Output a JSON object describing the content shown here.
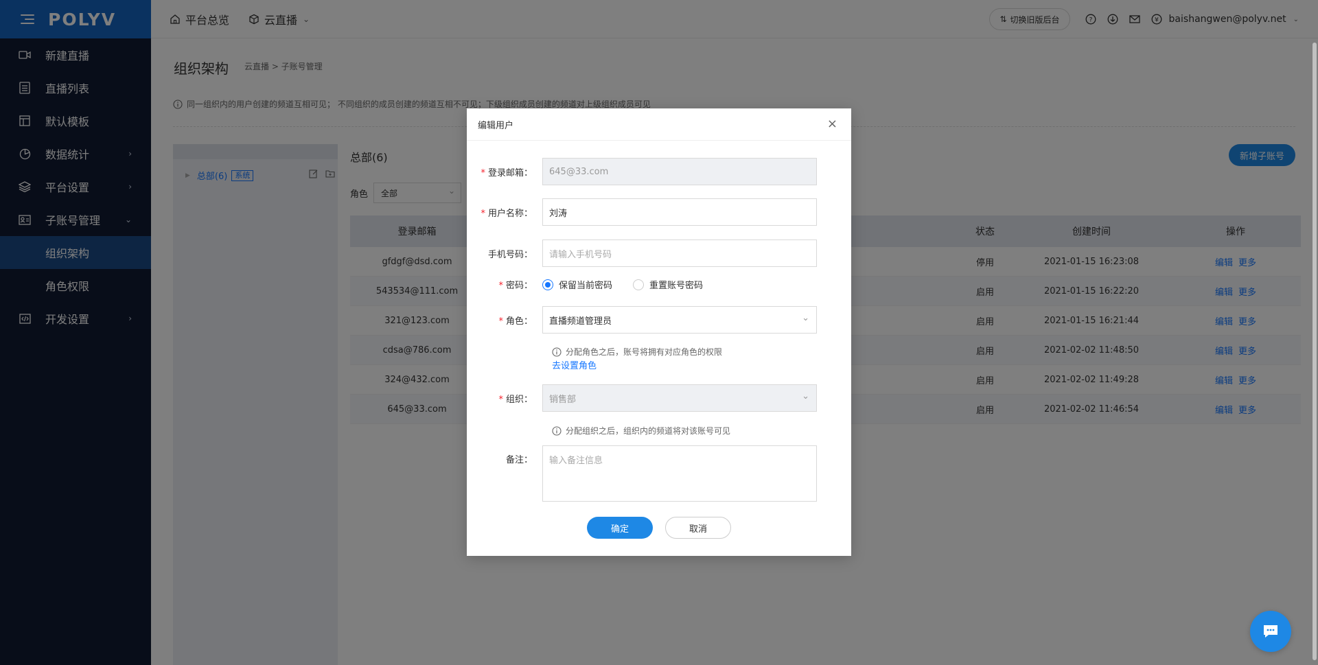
{
  "brand": {
    "logo": "POLYV",
    "accent": "#1565c0",
    "sidebar_bg": "#101a33"
  },
  "sidebar": {
    "items": [
      {
        "label": "新建直播",
        "icon": "video-camera-icon"
      },
      {
        "label": "直播列表",
        "icon": "list-icon"
      },
      {
        "label": "默认模板",
        "icon": "template-icon"
      },
      {
        "label": "数据统计",
        "icon": "pie-chart-icon"
      },
      {
        "label": "平台设置",
        "icon": "layers-icon"
      },
      {
        "label": "子账号管理",
        "icon": "id-card-icon"
      },
      {
        "label": "开发设置",
        "icon": "code-icon"
      }
    ],
    "sub_items": [
      {
        "label": "组织架构",
        "active": true
      },
      {
        "label": "角色权限",
        "active": false
      }
    ]
  },
  "topbar": {
    "nav": [
      {
        "label": "平台总览",
        "icon": "home-icon"
      },
      {
        "label": "云直播",
        "icon": "cube-icon"
      }
    ],
    "switch_label": "切换旧版后台",
    "user": "baishangwen@polyv.net"
  },
  "page": {
    "title": "组织架构",
    "breadcrumb": "云直播 >  子账号管理",
    "notice": "同一组织内的用户创建的频道互相可见；  不同组织的成员创建的频道互相不可见；下级组织成员创建的频道对上级组织成员可见"
  },
  "tree": {
    "node_label": "总部(6)",
    "tag": "系统"
  },
  "content": {
    "group_title": "总部(6)",
    "add_button": "新增子账号",
    "filter_label": "角色",
    "filter_value": "全部",
    "columns": {
      "email": "登录邮箱",
      "status": "状态",
      "created": "创建时间",
      "ops": "操作"
    },
    "rows": [
      {
        "email": "gfdgf@dsd.com",
        "status": "停用",
        "created": "2021-01-15 16:23:08"
      },
      {
        "email": "543534@111.com",
        "status": "启用",
        "created": "2021-01-15 16:22:20"
      },
      {
        "email": "321@123.com",
        "status": "启用",
        "created": "2021-01-15 16:21:44"
      },
      {
        "email": "cdsa@786.com",
        "status": "启用",
        "created": "2021-02-02 11:48:50"
      },
      {
        "email": "324@432.com",
        "status": "启用",
        "created": "2021-02-02 11:49:28"
      },
      {
        "email": "645@33.com",
        "status": "启用",
        "created": "2021-02-02 11:46:54"
      }
    ],
    "op_edit": "编辑",
    "op_more": "更多"
  },
  "modal": {
    "title": "编辑用户",
    "close": "×",
    "email_label": "登录邮箱：",
    "email_value": "645@33.com",
    "name_label": "用户名称：",
    "name_value": "刘涛",
    "phone_label": "手机号码：",
    "phone_placeholder": "请输入手机号码",
    "password_label": "密码：",
    "pw_keep": "保留当前密码",
    "pw_reset": "重置账号密码",
    "role_label": "角色：",
    "role_value": "直播频道管理员",
    "role_hint": "分配角色之后，账号将拥有对应角色的权限",
    "role_link": "去设置角色",
    "org_label": "组织：",
    "org_value": "销售部",
    "org_hint": "分配组织之后，组织内的频道将对该账号可见",
    "remark_label": "备注：",
    "remark_placeholder": "输入备注信息",
    "ok": "确定",
    "cancel": "取消"
  }
}
